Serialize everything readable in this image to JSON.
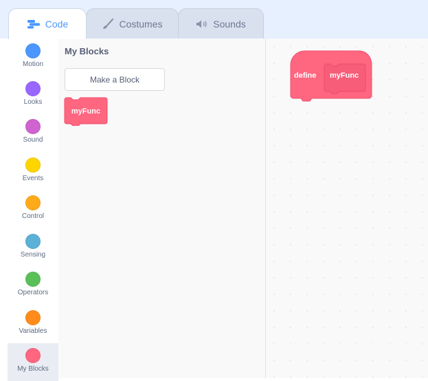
{
  "tabs": [
    {
      "label": "Code",
      "icon": "code-icon",
      "active": true
    },
    {
      "label": "Costumes",
      "icon": "brush-icon",
      "active": false
    },
    {
      "label": "Sounds",
      "icon": "speaker-icon",
      "active": false
    }
  ],
  "categories": [
    {
      "label": "Motion",
      "color": "#4c97ff"
    },
    {
      "label": "Looks",
      "color": "#9966ff"
    },
    {
      "label": "Sound",
      "color": "#cf63cf"
    },
    {
      "label": "Events",
      "color": "#ffd500"
    },
    {
      "label": "Control",
      "color": "#ffab19"
    },
    {
      "label": "Sensing",
      "color": "#5cb1d6"
    },
    {
      "label": "Operators",
      "color": "#59c059"
    },
    {
      "label": "Variables",
      "color": "#ff8c1a"
    },
    {
      "label": "My Blocks",
      "color": "#ff6680",
      "selected": true
    }
  ],
  "flyout": {
    "title": "My Blocks",
    "make_block_label": "Make a Block",
    "block_label": "myFunc"
  },
  "script": {
    "define_label": "define",
    "proto_label": "myFunc"
  },
  "colors": {
    "accent": "#4c97ff",
    "my_blocks": "#ff6680",
    "my_blocks_dark": "#ff4d6a"
  }
}
